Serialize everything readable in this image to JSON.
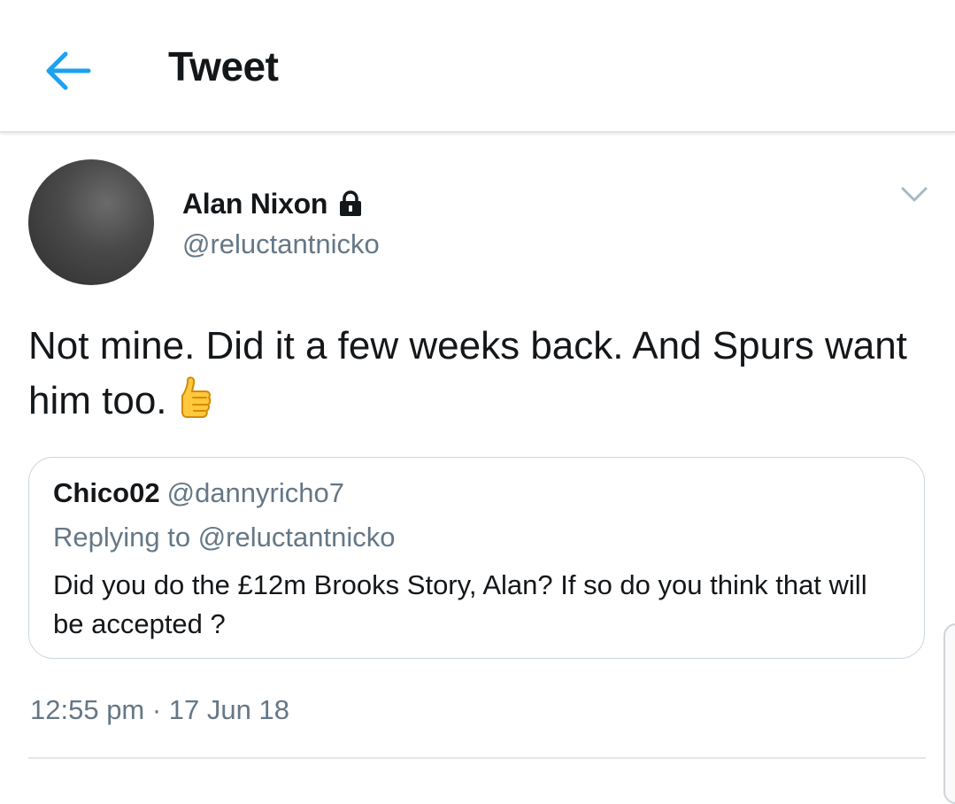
{
  "header": {
    "title": "Tweet",
    "back_icon": "arrow-left-icon",
    "accent_color": "#1da1f2"
  },
  "author": {
    "name": "Alan Nixon",
    "handle": "@reluctantnicko",
    "protected_icon": "lock-icon"
  },
  "menu_icon": "chevron-down-icon",
  "tweet": {
    "text": "Not mine. Did it a few weeks back. And Spurs want him too.",
    "emoji_icon": "thumbs-up-icon"
  },
  "quoted_tweet": {
    "name": "Chico02",
    "handle": "@dannyricho7",
    "replying_to": "Replying to @reluctantnicko",
    "text": "Did you do the £12m Brooks Story, Alan? If so do you think that will be accepted ?"
  },
  "timestamp": "12:55 pm · 17 Jun 18",
  "colors": {
    "text_primary": "#14171a",
    "text_secondary": "#657786",
    "border": "#ccd6dd"
  }
}
